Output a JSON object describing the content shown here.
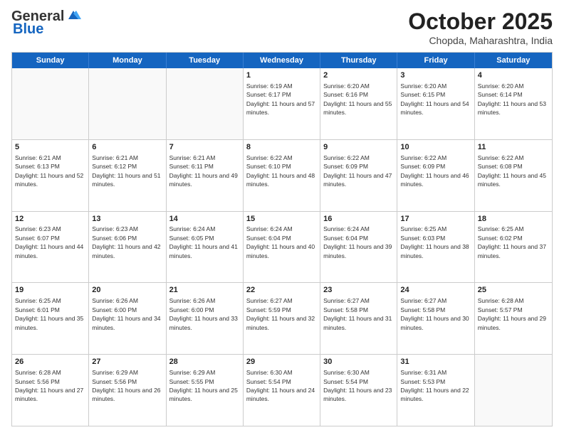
{
  "header": {
    "logo_general": "General",
    "logo_blue": "Blue",
    "month_title": "October 2025",
    "location": "Chopda, Maharashtra, India"
  },
  "days_of_week": [
    "Sunday",
    "Monday",
    "Tuesday",
    "Wednesday",
    "Thursday",
    "Friday",
    "Saturday"
  ],
  "weeks": [
    [
      {
        "day": "",
        "sunrise": "",
        "sunset": "",
        "daylight": ""
      },
      {
        "day": "",
        "sunrise": "",
        "sunset": "",
        "daylight": ""
      },
      {
        "day": "",
        "sunrise": "",
        "sunset": "",
        "daylight": ""
      },
      {
        "day": "1",
        "sunrise": "Sunrise: 6:19 AM",
        "sunset": "Sunset: 6:17 PM",
        "daylight": "Daylight: 11 hours and 57 minutes."
      },
      {
        "day": "2",
        "sunrise": "Sunrise: 6:20 AM",
        "sunset": "Sunset: 6:16 PM",
        "daylight": "Daylight: 11 hours and 55 minutes."
      },
      {
        "day": "3",
        "sunrise": "Sunrise: 6:20 AM",
        "sunset": "Sunset: 6:15 PM",
        "daylight": "Daylight: 11 hours and 54 minutes."
      },
      {
        "day": "4",
        "sunrise": "Sunrise: 6:20 AM",
        "sunset": "Sunset: 6:14 PM",
        "daylight": "Daylight: 11 hours and 53 minutes."
      }
    ],
    [
      {
        "day": "5",
        "sunrise": "Sunrise: 6:21 AM",
        "sunset": "Sunset: 6:13 PM",
        "daylight": "Daylight: 11 hours and 52 minutes."
      },
      {
        "day": "6",
        "sunrise": "Sunrise: 6:21 AM",
        "sunset": "Sunset: 6:12 PM",
        "daylight": "Daylight: 11 hours and 51 minutes."
      },
      {
        "day": "7",
        "sunrise": "Sunrise: 6:21 AM",
        "sunset": "Sunset: 6:11 PM",
        "daylight": "Daylight: 11 hours and 49 minutes."
      },
      {
        "day": "8",
        "sunrise": "Sunrise: 6:22 AM",
        "sunset": "Sunset: 6:10 PM",
        "daylight": "Daylight: 11 hours and 48 minutes."
      },
      {
        "day": "9",
        "sunrise": "Sunrise: 6:22 AM",
        "sunset": "Sunset: 6:09 PM",
        "daylight": "Daylight: 11 hours and 47 minutes."
      },
      {
        "day": "10",
        "sunrise": "Sunrise: 6:22 AM",
        "sunset": "Sunset: 6:09 PM",
        "daylight": "Daylight: 11 hours and 46 minutes."
      },
      {
        "day": "11",
        "sunrise": "Sunrise: 6:22 AM",
        "sunset": "Sunset: 6:08 PM",
        "daylight": "Daylight: 11 hours and 45 minutes."
      }
    ],
    [
      {
        "day": "12",
        "sunrise": "Sunrise: 6:23 AM",
        "sunset": "Sunset: 6:07 PM",
        "daylight": "Daylight: 11 hours and 44 minutes."
      },
      {
        "day": "13",
        "sunrise": "Sunrise: 6:23 AM",
        "sunset": "Sunset: 6:06 PM",
        "daylight": "Daylight: 11 hours and 42 minutes."
      },
      {
        "day": "14",
        "sunrise": "Sunrise: 6:24 AM",
        "sunset": "Sunset: 6:05 PM",
        "daylight": "Daylight: 11 hours and 41 minutes."
      },
      {
        "day": "15",
        "sunrise": "Sunrise: 6:24 AM",
        "sunset": "Sunset: 6:04 PM",
        "daylight": "Daylight: 11 hours and 40 minutes."
      },
      {
        "day": "16",
        "sunrise": "Sunrise: 6:24 AM",
        "sunset": "Sunset: 6:04 PM",
        "daylight": "Daylight: 11 hours and 39 minutes."
      },
      {
        "day": "17",
        "sunrise": "Sunrise: 6:25 AM",
        "sunset": "Sunset: 6:03 PM",
        "daylight": "Daylight: 11 hours and 38 minutes."
      },
      {
        "day": "18",
        "sunrise": "Sunrise: 6:25 AM",
        "sunset": "Sunset: 6:02 PM",
        "daylight": "Daylight: 11 hours and 37 minutes."
      }
    ],
    [
      {
        "day": "19",
        "sunrise": "Sunrise: 6:25 AM",
        "sunset": "Sunset: 6:01 PM",
        "daylight": "Daylight: 11 hours and 35 minutes."
      },
      {
        "day": "20",
        "sunrise": "Sunrise: 6:26 AM",
        "sunset": "Sunset: 6:00 PM",
        "daylight": "Daylight: 11 hours and 34 minutes."
      },
      {
        "day": "21",
        "sunrise": "Sunrise: 6:26 AM",
        "sunset": "Sunset: 6:00 PM",
        "daylight": "Daylight: 11 hours and 33 minutes."
      },
      {
        "day": "22",
        "sunrise": "Sunrise: 6:27 AM",
        "sunset": "Sunset: 5:59 PM",
        "daylight": "Daylight: 11 hours and 32 minutes."
      },
      {
        "day": "23",
        "sunrise": "Sunrise: 6:27 AM",
        "sunset": "Sunset: 5:58 PM",
        "daylight": "Daylight: 11 hours and 31 minutes."
      },
      {
        "day": "24",
        "sunrise": "Sunrise: 6:27 AM",
        "sunset": "Sunset: 5:58 PM",
        "daylight": "Daylight: 11 hours and 30 minutes."
      },
      {
        "day": "25",
        "sunrise": "Sunrise: 6:28 AM",
        "sunset": "Sunset: 5:57 PM",
        "daylight": "Daylight: 11 hours and 29 minutes."
      }
    ],
    [
      {
        "day": "26",
        "sunrise": "Sunrise: 6:28 AM",
        "sunset": "Sunset: 5:56 PM",
        "daylight": "Daylight: 11 hours and 27 minutes."
      },
      {
        "day": "27",
        "sunrise": "Sunrise: 6:29 AM",
        "sunset": "Sunset: 5:56 PM",
        "daylight": "Daylight: 11 hours and 26 minutes."
      },
      {
        "day": "28",
        "sunrise": "Sunrise: 6:29 AM",
        "sunset": "Sunset: 5:55 PM",
        "daylight": "Daylight: 11 hours and 25 minutes."
      },
      {
        "day": "29",
        "sunrise": "Sunrise: 6:30 AM",
        "sunset": "Sunset: 5:54 PM",
        "daylight": "Daylight: 11 hours and 24 minutes."
      },
      {
        "day": "30",
        "sunrise": "Sunrise: 6:30 AM",
        "sunset": "Sunset: 5:54 PM",
        "daylight": "Daylight: 11 hours and 23 minutes."
      },
      {
        "day": "31",
        "sunrise": "Sunrise: 6:31 AM",
        "sunset": "Sunset: 5:53 PM",
        "daylight": "Daylight: 11 hours and 22 minutes."
      },
      {
        "day": "",
        "sunrise": "",
        "sunset": "",
        "daylight": ""
      }
    ]
  ]
}
